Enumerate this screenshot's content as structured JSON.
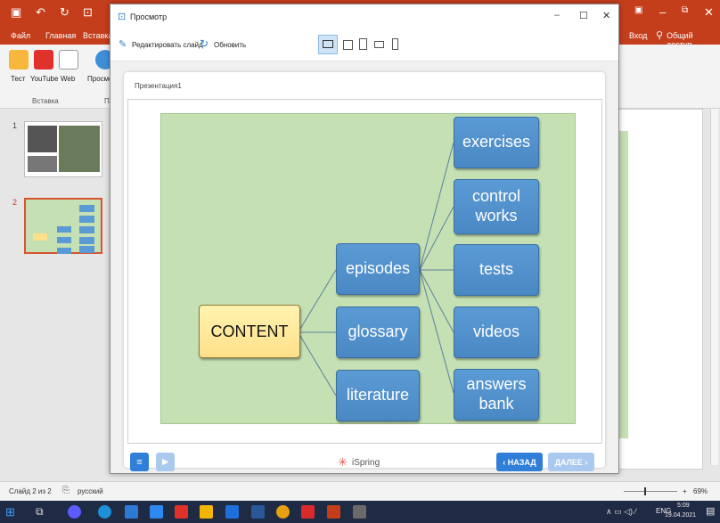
{
  "ppt": {
    "menu_tabs": [
      "Файл",
      "Главная",
      "Вставка"
    ],
    "right_links": {
      "login": "Вход",
      "share": "Общий доступ"
    },
    "ribbon": {
      "items": [
        "Тест",
        "YouTube",
        "Web",
        "Просмо"
      ],
      "group_labels": [
        "Вставка",
        "П"
      ]
    },
    "thumb_numbers": [
      "1",
      "2"
    ],
    "status": {
      "slide_info": "Слайд 2 из 2",
      "language": "русский",
      "zoom": "69%"
    },
    "taskbar": {
      "lang": "ENG",
      "time": "5:09",
      "date": "19.04.2021"
    }
  },
  "preview": {
    "window_title": "Просмотр",
    "toolbar": {
      "edit_label": "Редактировать слайд",
      "refresh_label": "Обновить"
    },
    "presentation_title": "Презентация1",
    "footer": {
      "brand": "iSpring",
      "back_label": "‹ НАЗАД",
      "next_label": "ДАЛЕЕ ›"
    }
  },
  "diagram": {
    "root": "CONTENT",
    "level1": [
      "episodes",
      "glossary",
      "literature"
    ],
    "level2": [
      "exercises",
      "control works",
      "tests",
      "videos",
      "answers bank"
    ]
  },
  "colors": {
    "ppt_accent": "#c43e1c",
    "node_blue": "#5b9bd5",
    "root_yellow": "#ffe699",
    "diagram_bg": "#c5e0b3",
    "ispring_button": "#2f7ed8"
  }
}
